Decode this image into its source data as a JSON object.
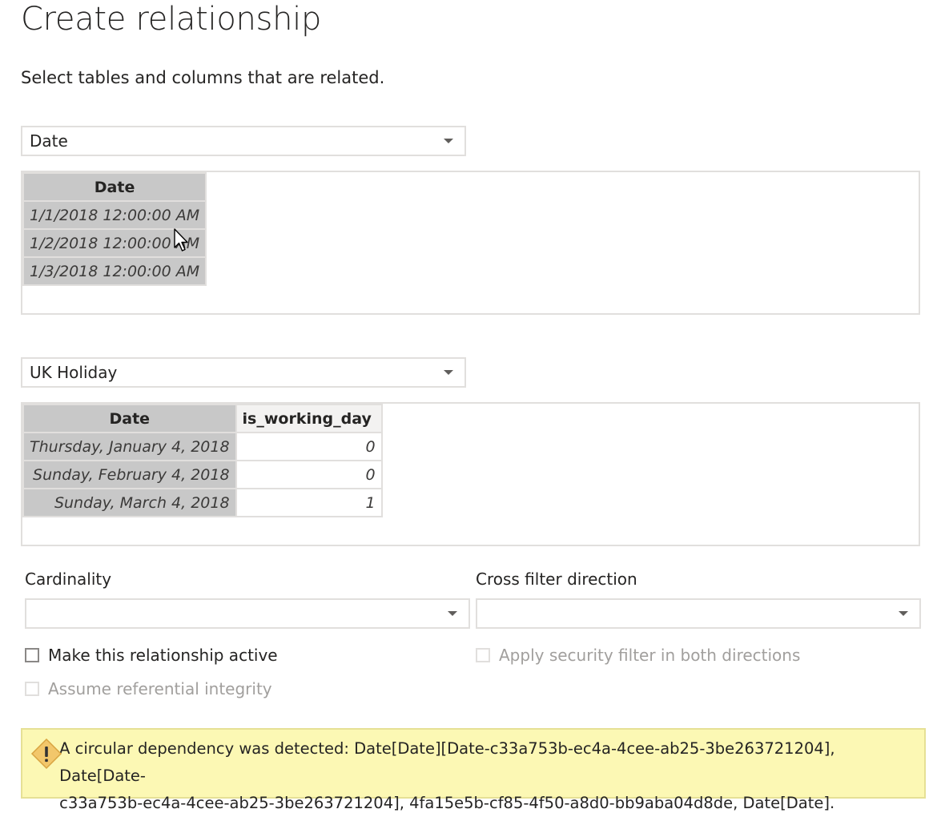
{
  "dialog": {
    "title": "Create relationship",
    "subtitle": "Select tables and columns that are related."
  },
  "table1": {
    "selected_table": "Date",
    "columns": [
      "Date"
    ],
    "rows": [
      [
        "1/1/2018 12:00:00 AM"
      ],
      [
        "1/2/2018 12:00:00 AM"
      ],
      [
        "1/3/2018 12:00:00 AM"
      ]
    ]
  },
  "table2": {
    "selected_table": "UK Holiday",
    "columns": [
      "Date",
      "is_working_day"
    ],
    "rows": [
      [
        "Thursday, January 4, 2018",
        "0"
      ],
      [
        "Sunday, February 4, 2018",
        "0"
      ],
      [
        "Sunday, March 4, 2018",
        "1"
      ]
    ]
  },
  "cardinality": {
    "label": "Cardinality",
    "value": ""
  },
  "cross_filter": {
    "label": "Cross filter direction",
    "value": ""
  },
  "options": {
    "make_active": {
      "label": "Make this relationship active",
      "checked": false,
      "enabled": true
    },
    "security_filter": {
      "label": "Apply security filter in both directions",
      "checked": false,
      "enabled": false
    },
    "referential_integrity": {
      "label": "Assume referential integrity",
      "checked": false,
      "enabled": false
    }
  },
  "warning": {
    "icon": "warning-icon",
    "line1": "A circular dependency was detected: Date[Date][Date-c33a753b-ec4a-4cee-ab25-3be263721204], Date[Date-",
    "line2": "c33a753b-ec4a-4cee-ab25-3be263721204], 4fa15e5b-cf85-4f50-a8d0-bb9aba04d8de, Date[Date]."
  },
  "colors": {
    "selected_column": "#c8c8c8",
    "warning_background": "#fcf8b4",
    "border": "#e1dfdd"
  }
}
